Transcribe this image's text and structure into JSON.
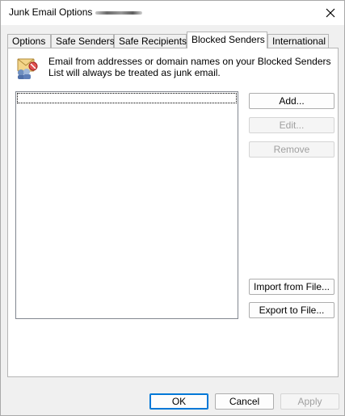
{
  "window": {
    "title": "Junk Email Options -",
    "close_label": "✕"
  },
  "tabs": [
    {
      "label": "Options"
    },
    {
      "label": "Safe Senders"
    },
    {
      "label": "Safe Recipients"
    },
    {
      "label": "Blocked Senders"
    },
    {
      "label": "International"
    }
  ],
  "active_tab": "Blocked Senders",
  "panel": {
    "icon": "blocked-senders-icon",
    "description": "Email from addresses or domain names on your Blocked Senders List will always be treated as junk email.",
    "list_items": []
  },
  "buttons": {
    "add": "Add...",
    "edit": "Edit...",
    "remove": "Remove",
    "import": "Import from File...",
    "export": "Export to File..."
  },
  "footer": {
    "ok": "OK",
    "cancel": "Cancel",
    "apply": "Apply"
  },
  "colors": {
    "accent": "#0078d7",
    "disabled_text": "#a0a0a0",
    "panel_bg": "#ffffff",
    "window_bg": "#f0f0f0"
  }
}
